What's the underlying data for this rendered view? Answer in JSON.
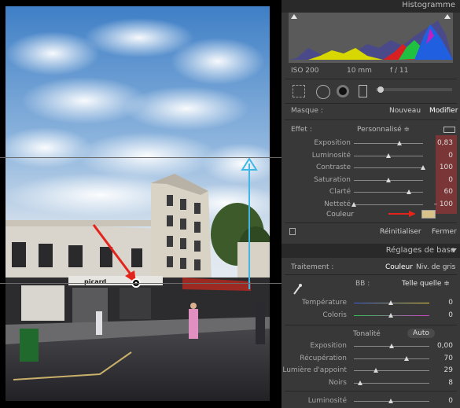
{
  "histogram": {
    "title": "Histogramme",
    "iso": "ISO 200",
    "focal": "10 mm",
    "aperture": "f / 11"
  },
  "mask": {
    "label": "Masque :",
    "new": "Nouveau",
    "edit": "Modifier"
  },
  "effect": {
    "label": "Effet :",
    "preset": "Personnalisé ≑",
    "sliders": [
      {
        "label": "Exposition",
        "value": "0,83",
        "pos": 0.66
      },
      {
        "label": "Luminosité",
        "value": "0",
        "pos": 0.5
      },
      {
        "label": "Contraste",
        "value": "100",
        "pos": 1.0
      },
      {
        "label": "Saturation",
        "value": "0",
        "pos": 0.5
      },
      {
        "label": "Clarté",
        "value": "60",
        "pos": 0.8
      },
      {
        "label": "Netteté",
        "value": "– 100",
        "pos": 0.0
      }
    ],
    "color_label": "Couleur",
    "color_swatch": "#d8c28a",
    "reset": "Réinitialiser",
    "close": "Fermer"
  },
  "basic": {
    "title": "Réglages de base",
    "treatment_label": "Traitement :",
    "color": "Couleur",
    "bw": "Niv. de gris",
    "wb_label": "BB :",
    "wb_value": "Telle quelle ≑",
    "temp_label": "Température",
    "temp_value": "0",
    "tint_label": "Coloris",
    "tint_value": "0",
    "tone_label": "Tonalité",
    "auto": "Auto",
    "tone_sliders": [
      {
        "label": "Exposition",
        "value": "0,00",
        "pos": 0.5
      },
      {
        "label": "Récupération",
        "value": "70",
        "pos": 0.7
      },
      {
        "label": "Lumière d'appoint",
        "value": "29",
        "pos": 0.29
      },
      {
        "label": "Noirs",
        "value": "8",
        "pos": 0.08
      }
    ],
    "brightness_label": "Luminosité",
    "brightness_value": "0"
  }
}
